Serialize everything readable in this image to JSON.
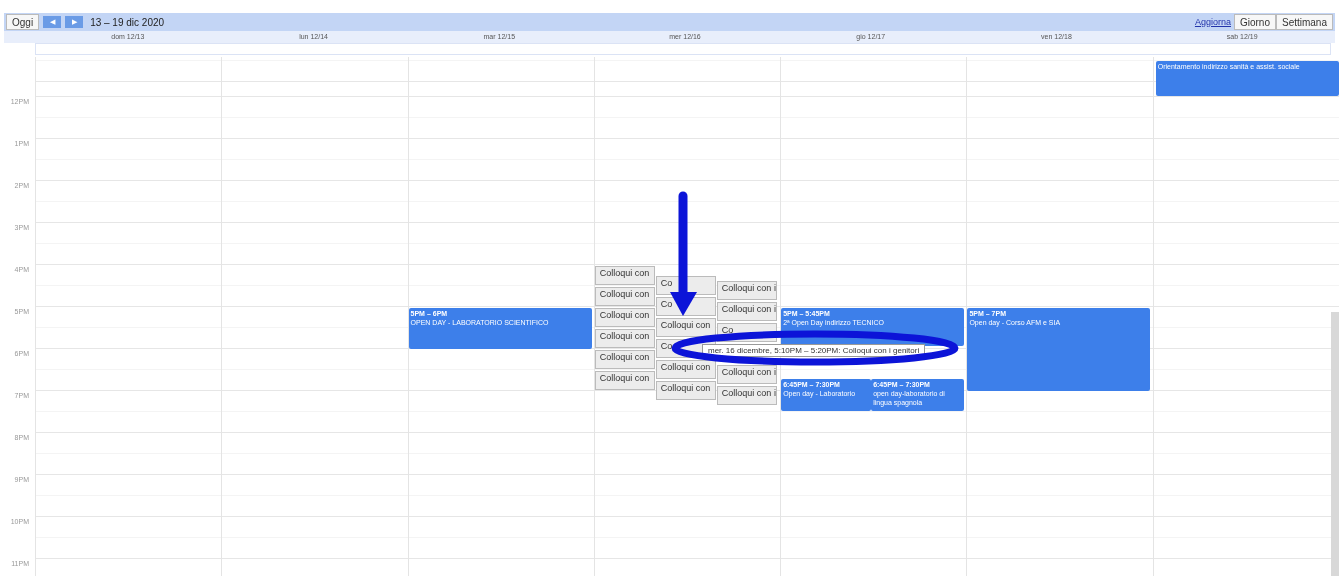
{
  "toolbar": {
    "today": "Oggi",
    "prev": "◀",
    "next": "▶",
    "range": "13 – 19 dic 2020",
    "refresh": "Aggiorna",
    "views": [
      "Giorno",
      "Settimana"
    ]
  },
  "days": [
    {
      "header": "dom 12/13"
    },
    {
      "header": "lun 12/14"
    },
    {
      "header": "mar 12/15",
      "events": [
        {
          "kind": "event",
          "time": "5PM – 6PM",
          "title": "OPEN DAY - LABORATORIO SCIENTIFICO"
        }
      ]
    },
    {
      "header": "mer 12/16",
      "events": [
        {
          "kind": "appointment",
          "title": "Colloqui con"
        },
        {
          "kind": "appointment",
          "title": "Colloqui con"
        },
        {
          "kind": "appointment",
          "title": "Colloqui con"
        },
        {
          "kind": "appointment",
          "title": "Colloqui con"
        },
        {
          "kind": "appointment",
          "title": "Colloqui con"
        },
        {
          "kind": "appointment",
          "title": "Colloqui con"
        },
        {
          "kind": "appointment",
          "title": "Co"
        },
        {
          "kind": "appointment",
          "title": "Co"
        },
        {
          "kind": "appointment",
          "title": "Colloqui con"
        },
        {
          "kind": "appointment",
          "title": "Co"
        },
        {
          "kind": "appointment",
          "title": "Colloqui con"
        },
        {
          "kind": "appointment",
          "title": "Colloqui con"
        },
        {
          "kind": "appointment",
          "title": "Colloqui con i"
        },
        {
          "kind": "appointment",
          "title": "Colloqui con i"
        },
        {
          "kind": "appointment",
          "title": "Co"
        },
        {
          "kind": "appointment",
          "title": "Colloqui con i"
        },
        {
          "kind": "appointment",
          "title": "Colloqui con i"
        }
      ]
    },
    {
      "header": "gio 12/17",
      "events": [
        {
          "kind": "event",
          "time": "5PM – 5:45PM",
          "title": "2ª Open Day indirizzo TECNICO"
        },
        {
          "kind": "event",
          "time": "6:45PM – 7:30PM",
          "title": "Open day - Laboratorio"
        },
        {
          "kind": "event",
          "time": "6:45PM – 7:30PM",
          "title": "open day-laboratorio di lingua spagnola"
        }
      ]
    },
    {
      "header": "ven 12/18",
      "events": [
        {
          "kind": "event",
          "time": "5PM – 7PM",
          "title": "Open day - Corso AFM e SIA"
        }
      ]
    },
    {
      "header": "sab 12/19",
      "events": [
        {
          "kind": "event",
          "title": "Orientamento indirizzo sanità e assist. sociale"
        }
      ]
    }
  ],
  "hours": [
    "12PM",
    "1PM",
    "2PM",
    "3PM",
    "4PM",
    "5PM",
    "6PM",
    "7PM",
    "8PM",
    "9PM",
    "10PM",
    "11PM"
  ],
  "tooltip": "mer. 16 dicembre, 5:10PM – 5:20PM: Colloqui con i genitori"
}
